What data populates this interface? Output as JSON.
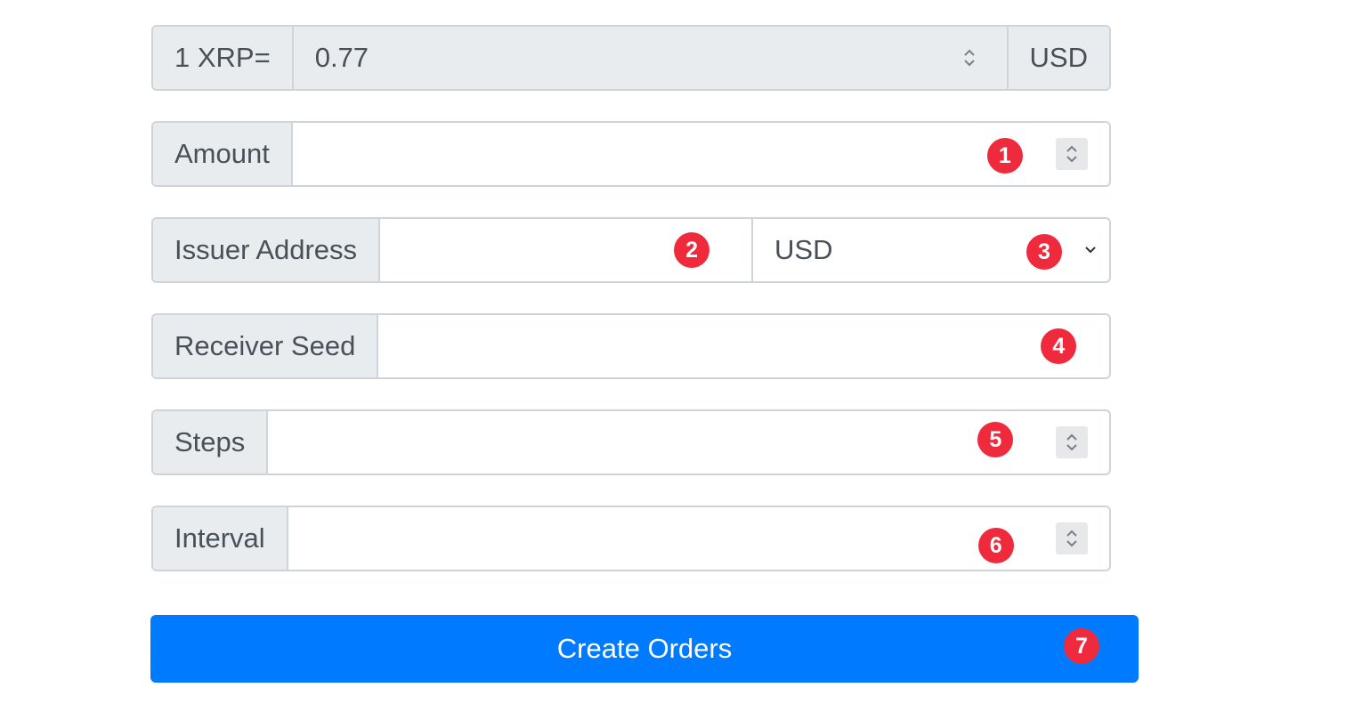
{
  "rate": {
    "prefix": "1 XRP=",
    "value": "0.77",
    "currency": "USD"
  },
  "fields": {
    "amount": {
      "label": "Amount",
      "value": ""
    },
    "issuer": {
      "label": "Issuer Address",
      "value": "",
      "currency_selected": "USD"
    },
    "receiver_seed": {
      "label": "Receiver Seed",
      "value": ""
    },
    "steps": {
      "label": "Steps",
      "value": ""
    },
    "interval": {
      "label": "Interval",
      "value": ""
    }
  },
  "submit_label": "Create Orders",
  "markers": [
    "1",
    "2",
    "3",
    "4",
    "5",
    "6",
    "7"
  ],
  "icons": {
    "spinner": "number-spinner-icon",
    "dropdown": "chevron-down-icon"
  },
  "colors": {
    "primary": "#007bff",
    "addon_bg": "#e9ecef",
    "border": "#ced4da",
    "marker": "#ee2a3c"
  }
}
